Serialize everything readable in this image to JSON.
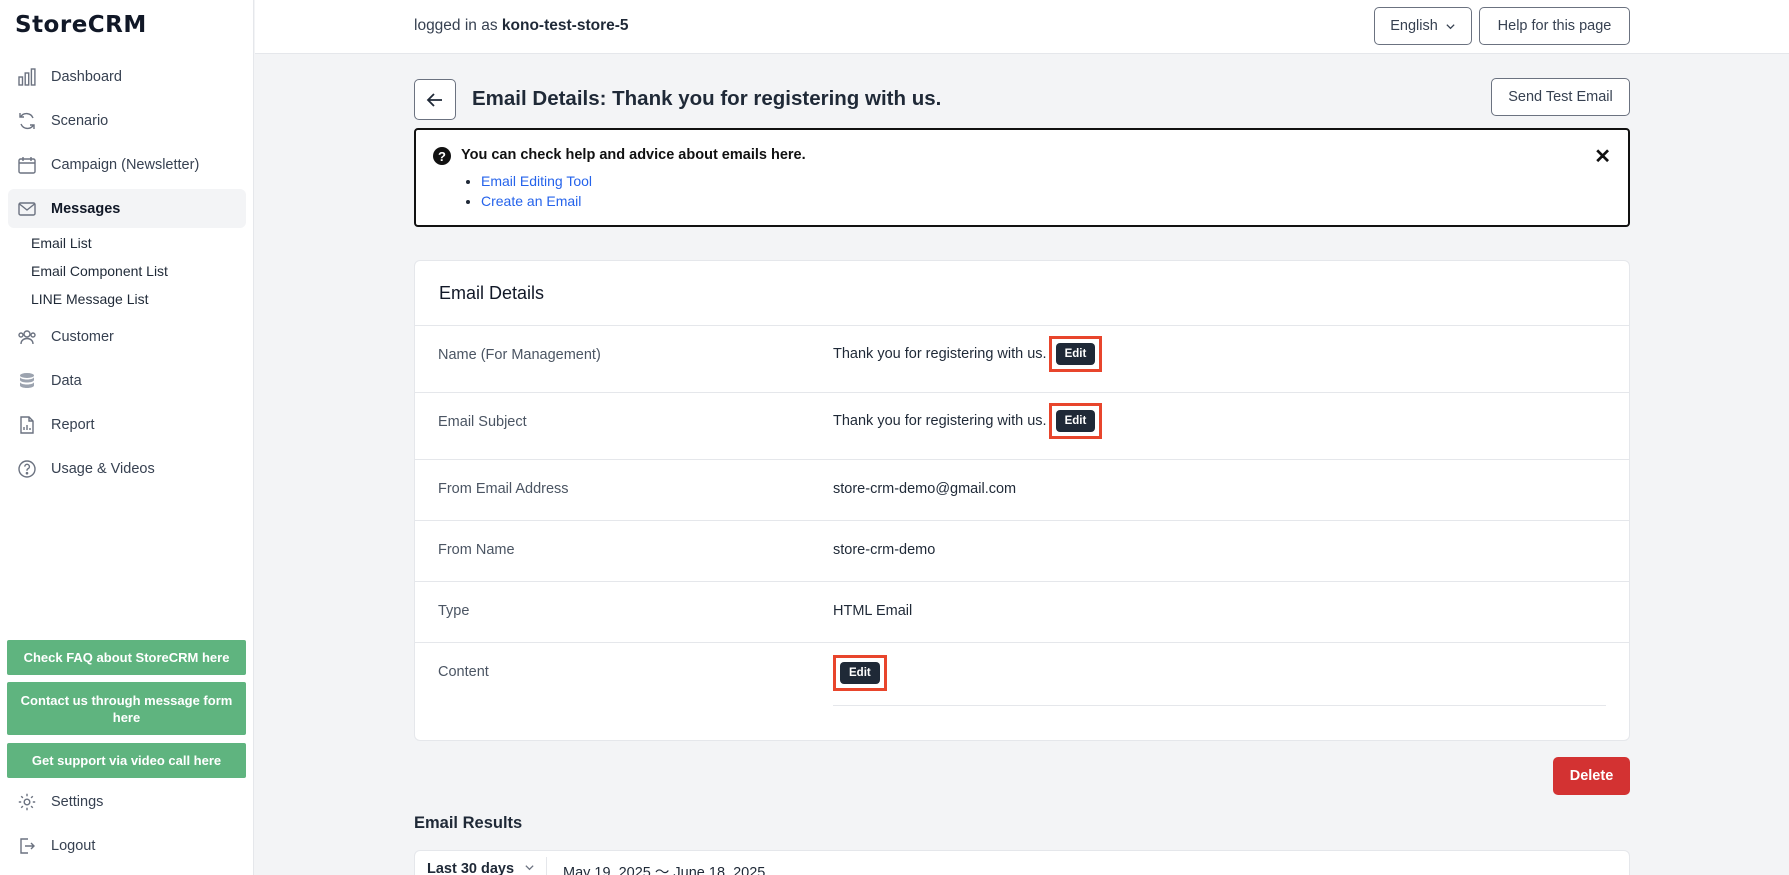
{
  "app": {
    "logo": "StoreCRM"
  },
  "sidebar": {
    "nav": [
      {
        "label": "Dashboard",
        "icon": "bar-chart-icon"
      },
      {
        "label": "Scenario",
        "icon": "refresh-icon"
      },
      {
        "label": "Campaign (Newsletter)",
        "icon": "calendar-icon"
      },
      {
        "label": "Messages",
        "icon": "mail-icon",
        "active": true
      },
      {
        "label": "Customer",
        "icon": "users-icon"
      },
      {
        "label": "Data",
        "icon": "database-icon"
      },
      {
        "label": "Report",
        "icon": "report-icon"
      },
      {
        "label": "Usage & Videos",
        "icon": "help-circle-icon"
      }
    ],
    "sub_items": [
      "Email List",
      "Email Component List",
      "LINE Message List"
    ],
    "support_buttons": [
      "Check FAQ about StoreCRM here",
      "Contact us through message form here",
      "Get support via video call here"
    ],
    "bottom": [
      {
        "label": "Settings",
        "icon": "gear-icon"
      },
      {
        "label": "Logout",
        "icon": "logout-icon"
      }
    ]
  },
  "topbar": {
    "login_prefix": "logged in as",
    "username": "kono-test-store-5",
    "language": "English",
    "help_button": "Help for this page"
  },
  "page": {
    "title": "Email Details: Thank you for registering with us.",
    "send_test_label": "Send Test Email"
  },
  "help_box": {
    "title": "You can check help and advice about emails here.",
    "links": [
      "Email Editing Tool",
      "Create an Email"
    ],
    "close": "✕"
  },
  "details": {
    "title": "Email Details",
    "edit_label": "Edit",
    "rows": [
      {
        "label": "Name (For Management)",
        "value": "Thank you for registering with us."
      },
      {
        "label": "Email Subject",
        "value": "Thank you for registering with us."
      },
      {
        "label": "From Email Address",
        "value": "store-crm-demo@gmail.com"
      },
      {
        "label": "From Name",
        "value": "store-crm-demo"
      },
      {
        "label": "Type",
        "value": "HTML Email"
      },
      {
        "label": "Content",
        "value": ""
      }
    ]
  },
  "delete_label": "Delete",
  "results": {
    "title": "Email Results",
    "range": "Last 30 days",
    "dates": "May 19, 2025 〜 June 18, 2025"
  },
  "colors": {
    "accent_green": "#5fb47f",
    "delete_red": "#d33232",
    "highlight": "#e8452c",
    "link": "#2563eb"
  }
}
